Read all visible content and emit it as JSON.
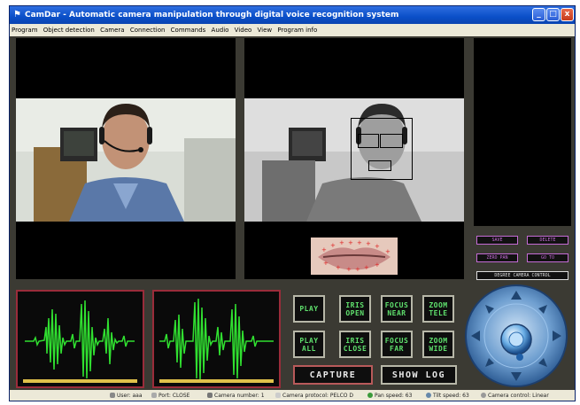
{
  "window": {
    "title": "CamDar - Automatic camera manipulation through digital voice recognition system",
    "minimize": "_",
    "maximize": "□",
    "close": "x"
  },
  "menu": [
    "Program",
    "Object detection",
    "Camera",
    "Connection",
    "Commands",
    "Audio",
    "Video",
    "View",
    "Program info"
  ],
  "commands": {
    "play": "PLAY",
    "iris_open": "IRIS OPEN",
    "focus_near": "FOCUS NEAR",
    "zoom_tele": "ZOOM TELE",
    "play_all": "PLAY ALL",
    "iris_close": "IRIS CLOSE",
    "focus_far": "FOCUS FAR",
    "zoom_wide": "ZOOM WIDE",
    "capture": "CAPTURE",
    "show_log": "SHOW LOG"
  },
  "presets": {
    "save": "SAVE",
    "delete": "DELETE",
    "zero_pan": "ZERO PAN",
    "go_to": "GO TO",
    "degree_camera_control": "DEGREE CAMERA CONTROL"
  },
  "status": {
    "user": "User: aaa",
    "port": "Port: CLOSE",
    "camera_number": "Camera number: 1",
    "camera_protocol": "Camera protocol: PELCO D",
    "pan_speed": "Pan speed: 63",
    "tilt_speed": "Tilt speed: 63",
    "camera_control": "Camera control: Linear"
  },
  "icons": {
    "app": "camera-icon",
    "joystick": "ptz-joystick-icon"
  },
  "colors": {
    "accent_green": "#5fe06d",
    "preset_purple": "#c46bd5",
    "wave_green": "#30e030",
    "wave_border": "#9a2c3a"
  }
}
